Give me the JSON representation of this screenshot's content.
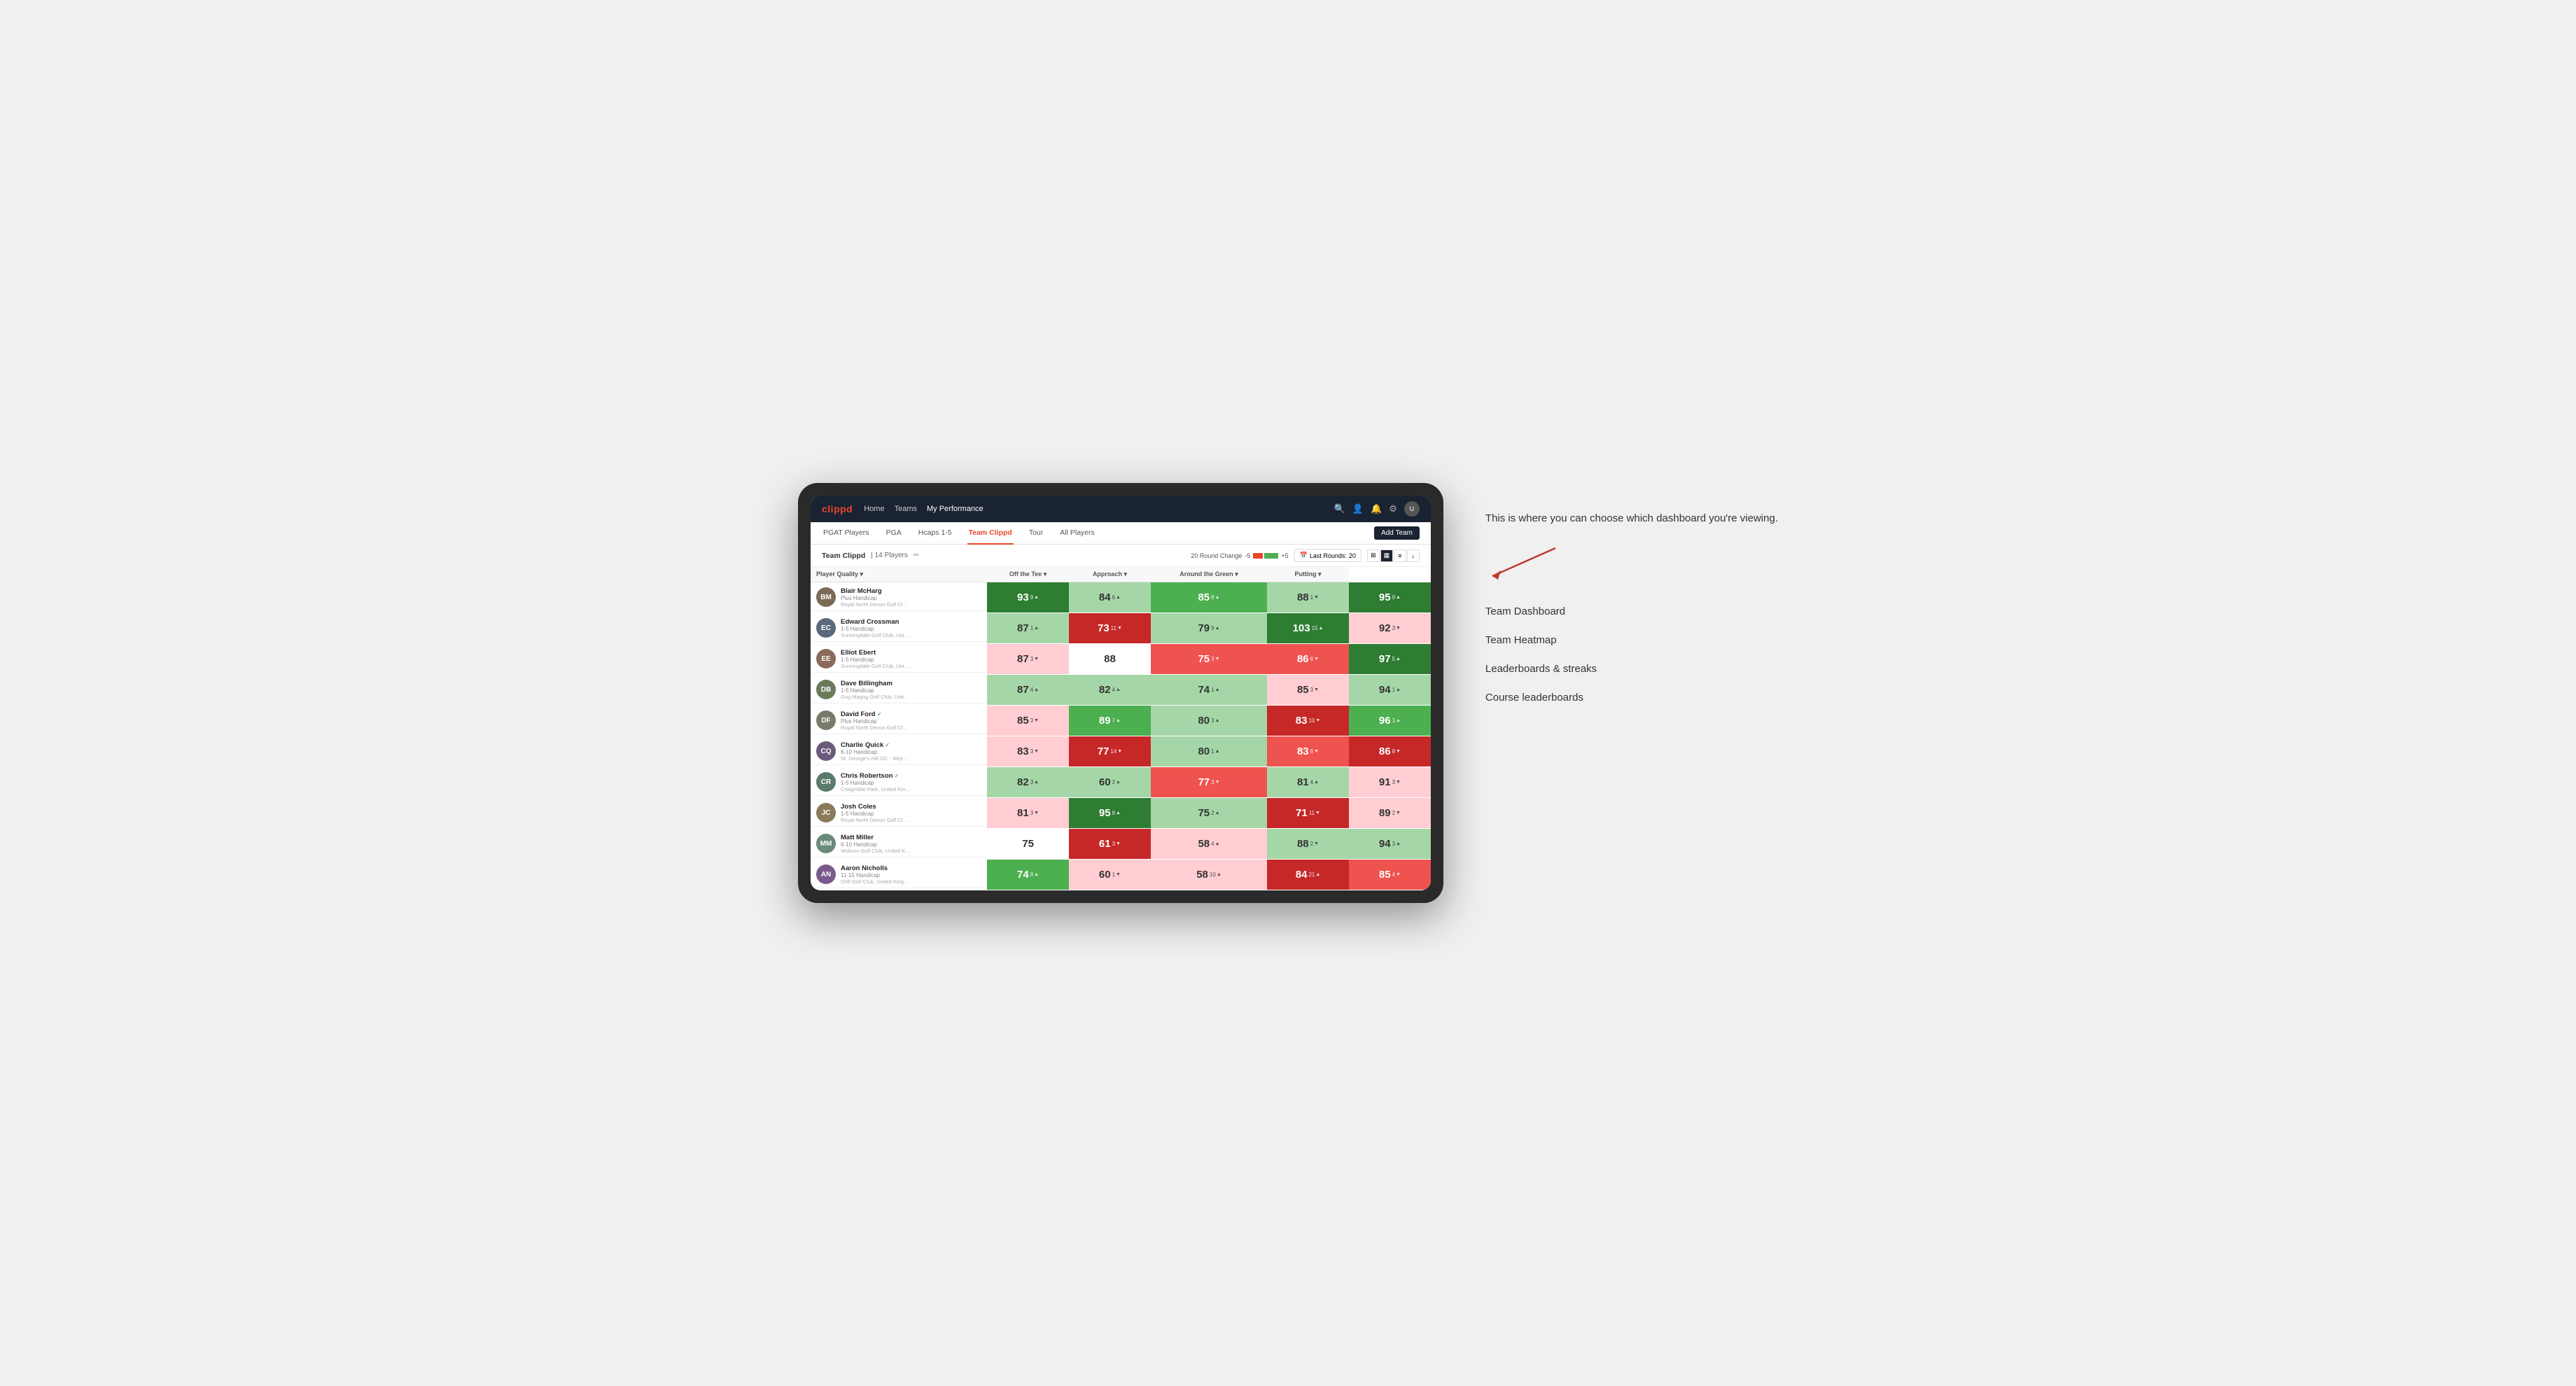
{
  "annotation": {
    "intro_text": "This is where you can choose which dashboard you're viewing.",
    "menu_items": [
      {
        "label": "Team Dashboard"
      },
      {
        "label": "Team Heatmap"
      },
      {
        "label": "Leaderboards & streaks"
      },
      {
        "label": "Course leaderboards"
      }
    ]
  },
  "nav": {
    "logo": "clippd",
    "links": [
      {
        "label": "Home",
        "active": false
      },
      {
        "label": "Teams",
        "active": false
      },
      {
        "label": "My Performance",
        "active": true
      }
    ]
  },
  "sub_nav": {
    "links": [
      {
        "label": "PGAT Players"
      },
      {
        "label": "PGA"
      },
      {
        "label": "Hcaps 1-5"
      },
      {
        "label": "Team Clippd",
        "active": true
      },
      {
        "label": "Tour"
      },
      {
        "label": "All Players"
      }
    ],
    "add_team_label": "Add Team"
  },
  "team_header": {
    "name": "Team Clippd",
    "separator": "|",
    "count": "14 Players",
    "round_change_label": "20 Round Change",
    "range_low": "-5",
    "range_high": "+5",
    "last_rounds_label": "Last Rounds:",
    "last_rounds_value": "20"
  },
  "table": {
    "columns": [
      {
        "label": "Player Quality ▾",
        "key": "player_quality"
      },
      {
        "label": "Off the Tee ▾",
        "key": "off_the_tee"
      },
      {
        "label": "Approach ▾",
        "key": "approach"
      },
      {
        "label": "Around the Green ▾",
        "key": "around_the_green"
      },
      {
        "label": "Putting ▾",
        "key": "putting"
      }
    ],
    "players": [
      {
        "name": "Blair McHarg",
        "handicap": "Plus Handicap",
        "club": "Royal North Devon Golf Club, United Kingdom",
        "initials": "BM",
        "avatar_color": "#7b6a55",
        "scores": [
          {
            "value": "93",
            "delta": "9",
            "dir": "up",
            "bg": "green-dark",
            "text": "white"
          },
          {
            "value": "84",
            "delta": "6",
            "dir": "up",
            "bg": "green-light",
            "text": "dark"
          },
          {
            "value": "85",
            "delta": "8",
            "dir": "up",
            "bg": "green-med",
            "text": "white"
          },
          {
            "value": "88",
            "delta": "1",
            "dir": "down",
            "bg": "green-light",
            "text": "dark"
          },
          {
            "value": "95",
            "delta": "9",
            "dir": "up",
            "bg": "green-dark",
            "text": "white"
          }
        ]
      },
      {
        "name": "Edward Crossman",
        "handicap": "1-5 Handicap",
        "club": "Sunningdale Golf Club, United Kingdom",
        "initials": "EC",
        "avatar_color": "#5a6a7a",
        "scores": [
          {
            "value": "87",
            "delta": "1",
            "dir": "up",
            "bg": "green-light",
            "text": "dark"
          },
          {
            "value": "73",
            "delta": "11",
            "dir": "down",
            "bg": "red-dark",
            "text": "white"
          },
          {
            "value": "79",
            "delta": "9",
            "dir": "up",
            "bg": "green-light",
            "text": "dark"
          },
          {
            "value": "103",
            "delta": "15",
            "dir": "up",
            "bg": "green-dark",
            "text": "white"
          },
          {
            "value": "92",
            "delta": "3",
            "dir": "down",
            "bg": "red-light",
            "text": "dark"
          }
        ]
      },
      {
        "name": "Elliot Ebert",
        "handicap": "1-5 Handicap",
        "club": "Sunningdale Golf Club, United Kingdom",
        "initials": "EE",
        "avatar_color": "#8a6a5a",
        "scores": [
          {
            "value": "87",
            "delta": "3",
            "dir": "down",
            "bg": "red-light",
            "text": "dark"
          },
          {
            "value": "88",
            "delta": "",
            "dir": "",
            "bg": "white",
            "text": "dark"
          },
          {
            "value": "75",
            "delta": "3",
            "dir": "down",
            "bg": "red-med",
            "text": "white"
          },
          {
            "value": "86",
            "delta": "6",
            "dir": "down",
            "bg": "red-med",
            "text": "white"
          },
          {
            "value": "97",
            "delta": "5",
            "dir": "up",
            "bg": "green-dark",
            "text": "white"
          }
        ]
      },
      {
        "name": "Dave Billingham",
        "handicap": "1-5 Handicap",
        "club": "Gog Magog Golf Club, United Kingdom",
        "initials": "DB",
        "avatar_color": "#6a7a5a",
        "scores": [
          {
            "value": "87",
            "delta": "4",
            "dir": "up",
            "bg": "green-light",
            "text": "dark"
          },
          {
            "value": "82",
            "delta": "4",
            "dir": "up",
            "bg": "green-light",
            "text": "dark"
          },
          {
            "value": "74",
            "delta": "1",
            "dir": "up",
            "bg": "green-light",
            "text": "dark"
          },
          {
            "value": "85",
            "delta": "3",
            "dir": "down",
            "bg": "red-light",
            "text": "dark"
          },
          {
            "value": "94",
            "delta": "1",
            "dir": "up",
            "bg": "green-light",
            "text": "dark"
          }
        ]
      },
      {
        "name": "David Ford",
        "handicap": "Plus Handicap",
        "club": "Royal North Devon Golf Club, United Kingdom",
        "initials": "DF",
        "avatar_color": "#7a7a6a",
        "verified": true,
        "scores": [
          {
            "value": "85",
            "delta": "3",
            "dir": "down",
            "bg": "red-light",
            "text": "dark"
          },
          {
            "value": "89",
            "delta": "7",
            "dir": "up",
            "bg": "green-med",
            "text": "white"
          },
          {
            "value": "80",
            "delta": "3",
            "dir": "up",
            "bg": "green-light",
            "text": "dark"
          },
          {
            "value": "83",
            "delta": "10",
            "dir": "down",
            "bg": "red-dark",
            "text": "white"
          },
          {
            "value": "96",
            "delta": "3",
            "dir": "up",
            "bg": "green-med",
            "text": "white"
          }
        ]
      },
      {
        "name": "Charlie Quick",
        "handicap": "6-10 Handicap",
        "club": "St. George's Hill GC - Weybridge - Surrey, Uni...",
        "initials": "CQ",
        "avatar_color": "#6a5a7a",
        "verified": true,
        "scores": [
          {
            "value": "83",
            "delta": "3",
            "dir": "down",
            "bg": "red-light",
            "text": "dark"
          },
          {
            "value": "77",
            "delta": "14",
            "dir": "down",
            "bg": "red-dark",
            "text": "white"
          },
          {
            "value": "80",
            "delta": "1",
            "dir": "up",
            "bg": "green-light",
            "text": "dark"
          },
          {
            "value": "83",
            "delta": "6",
            "dir": "down",
            "bg": "red-med",
            "text": "white"
          },
          {
            "value": "86",
            "delta": "8",
            "dir": "down",
            "bg": "red-dark",
            "text": "white"
          }
        ]
      },
      {
        "name": "Chris Robertson",
        "handicap": "1-5 Handicap",
        "club": "Craigmillar Park, United Kingdom",
        "initials": "CR",
        "avatar_color": "#5a7a6a",
        "verified": true,
        "scores": [
          {
            "value": "82",
            "delta": "3",
            "dir": "up",
            "bg": "green-light",
            "text": "dark"
          },
          {
            "value": "60",
            "delta": "2",
            "dir": "up",
            "bg": "green-light",
            "text": "dark"
          },
          {
            "value": "77",
            "delta": "3",
            "dir": "down",
            "bg": "red-med",
            "text": "white"
          },
          {
            "value": "81",
            "delta": "4",
            "dir": "up",
            "bg": "green-light",
            "text": "dark"
          },
          {
            "value": "91",
            "delta": "3",
            "dir": "down",
            "bg": "red-light",
            "text": "dark"
          }
        ]
      },
      {
        "name": "Josh Coles",
        "handicap": "1-5 Handicap",
        "club": "Royal North Devon Golf Club, United Kingdom",
        "initials": "JC",
        "avatar_color": "#8a7a5a",
        "scores": [
          {
            "value": "81",
            "delta": "3",
            "dir": "down",
            "bg": "red-light",
            "text": "dark"
          },
          {
            "value": "95",
            "delta": "8",
            "dir": "up",
            "bg": "green-dark",
            "text": "white"
          },
          {
            "value": "75",
            "delta": "2",
            "dir": "up",
            "bg": "green-light",
            "text": "dark"
          },
          {
            "value": "71",
            "delta": "11",
            "dir": "down",
            "bg": "red-dark",
            "text": "white"
          },
          {
            "value": "89",
            "delta": "2",
            "dir": "down",
            "bg": "red-light",
            "text": "dark"
          }
        ]
      },
      {
        "name": "Matt Miller",
        "handicap": "6-10 Handicap",
        "club": "Woburn Golf Club, United Kingdom",
        "initials": "MM",
        "avatar_color": "#6a8a7a",
        "scores": [
          {
            "value": "75",
            "delta": "",
            "dir": "",
            "bg": "white",
            "text": "dark"
          },
          {
            "value": "61",
            "delta": "3",
            "dir": "down",
            "bg": "red-dark",
            "text": "white"
          },
          {
            "value": "58",
            "delta": "4",
            "dir": "up",
            "bg": "red-light",
            "text": "dark"
          },
          {
            "value": "88",
            "delta": "2",
            "dir": "down",
            "bg": "green-light",
            "text": "dark"
          },
          {
            "value": "94",
            "delta": "3",
            "dir": "up",
            "bg": "green-light",
            "text": "dark"
          }
        ]
      },
      {
        "name": "Aaron Nicholls",
        "handicap": "11-15 Handicap",
        "club": "Drift Golf Club, United Kingdom",
        "initials": "AN",
        "avatar_color": "#7a5a8a",
        "scores": [
          {
            "value": "74",
            "delta": "8",
            "dir": "up",
            "bg": "green-med",
            "text": "white"
          },
          {
            "value": "60",
            "delta": "1",
            "dir": "down",
            "bg": "red-light",
            "text": "dark"
          },
          {
            "value": "58",
            "delta": "10",
            "dir": "up",
            "bg": "red-light",
            "text": "dark"
          },
          {
            "value": "84",
            "delta": "21",
            "dir": "up",
            "bg": "red-dark",
            "text": "white"
          },
          {
            "value": "85",
            "delta": "4",
            "dir": "down",
            "bg": "red-med",
            "text": "white"
          }
        ]
      }
    ]
  }
}
